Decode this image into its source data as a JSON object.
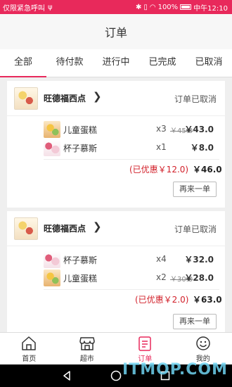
{
  "status_bar": {
    "carrier": "仅限紧急呼叫",
    "battery": "100%",
    "time": "中午12:10"
  },
  "header": {
    "title": "订单"
  },
  "tabs": [
    {
      "label": "全部",
      "active": true
    },
    {
      "label": "待付款",
      "active": false
    },
    {
      "label": "进行中",
      "active": false
    },
    {
      "label": "已完成",
      "active": false
    },
    {
      "label": "已取消",
      "active": false
    }
  ],
  "orders": [
    {
      "shop_name": "旺德福西点",
      "status": "订单已取消",
      "items": [
        {
          "name": "儿童蛋糕",
          "qty": "x3",
          "original_price": "￥45.0",
          "price": "￥43.0",
          "thumb": "cake"
        },
        {
          "name": "杯子慕斯",
          "qty": "x1",
          "original_price": "",
          "price": "￥8.0",
          "thumb": "mousse"
        }
      ],
      "discount": "(已优惠￥12.0)",
      "total": "￥46.0",
      "reorder_label": "再来一单"
    },
    {
      "shop_name": "旺德福西点",
      "status": "订单已取消",
      "items": [
        {
          "name": "杯子慕斯",
          "qty": "x4",
          "original_price": "",
          "price": "￥32.0",
          "thumb": "mousse"
        },
        {
          "name": "儿童蛋糕",
          "qty": "x2",
          "original_price": "￥30.0",
          "price": "￥28.0",
          "thumb": "cake"
        }
      ],
      "discount": "(已优惠￥2.0)",
      "total": "￥63.0",
      "reorder_label": "再来一单"
    }
  ],
  "bottom_nav": [
    {
      "label": "首页",
      "icon": "home-icon",
      "active": false
    },
    {
      "label": "超市",
      "icon": "store-icon",
      "active": false
    },
    {
      "label": "订单",
      "icon": "orders-icon",
      "active": true
    },
    {
      "label": "我的",
      "icon": "profile-icon",
      "active": false
    }
  ],
  "watermark": "ITMOP.COM",
  "colors": {
    "accent": "#e8295b",
    "discount": "#d2202a"
  }
}
